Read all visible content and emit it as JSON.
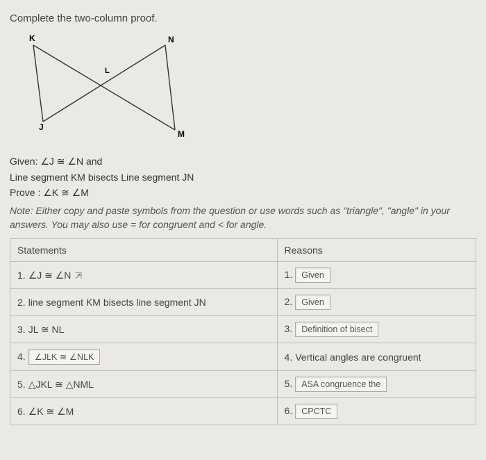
{
  "title": "Complete the two-column proof.",
  "diagram": {
    "labels": {
      "K": "K",
      "N": "N",
      "L": "L",
      "J": "J",
      "M": "M"
    }
  },
  "given": {
    "line1_prefix": "Given: ",
    "line1_math": "∠J ≅ ∠N and",
    "line2": "Line segment KM bisects Line segment JN",
    "prove_prefix": "Prove : ",
    "prove_math": "∠K ≅ ∠M"
  },
  "note": "Note: Either copy and paste symbols from the question or use words such as \"triangle\", \"angle\" in your answers. You may also use = for congruent and < for angle.",
  "headers": {
    "statements": "Statements",
    "reasons": "Reasons"
  },
  "rows": [
    {
      "s_num": "1.",
      "s_text": "∠J ≅ ∠N",
      "s_input": false,
      "s_cursor": true,
      "r_num": "1.",
      "r_text": "Given",
      "r_input": true
    },
    {
      "s_num": "2.",
      "s_text": "line segment KM bisects line segment JN",
      "s_input": false,
      "s_cursor": false,
      "r_num": "2.",
      "r_text": "Given",
      "r_input": true
    },
    {
      "s_num": "3.",
      "s_text": "JL ≅ NL",
      "s_input": false,
      "s_cursor": false,
      "r_num": "3.",
      "r_text": "Definition of bisect",
      "r_input": true
    },
    {
      "s_num": "4.",
      "s_text": "∠JLK ≅ ∠NLK",
      "s_input": true,
      "s_cursor": false,
      "r_num": "4.",
      "r_text": "Vertical angles are congruent",
      "r_input": false
    },
    {
      "s_num": "5.",
      "s_text": "△JKL ≅ △NML",
      "s_input": false,
      "s_cursor": false,
      "r_num": "5.",
      "r_text": "ASA congruence the",
      "r_input": true
    },
    {
      "s_num": "6.",
      "s_text": "∠K ≅ ∠M",
      "s_input": false,
      "s_cursor": false,
      "r_num": "6.",
      "r_text": "CPCTC",
      "r_input": true
    }
  ]
}
